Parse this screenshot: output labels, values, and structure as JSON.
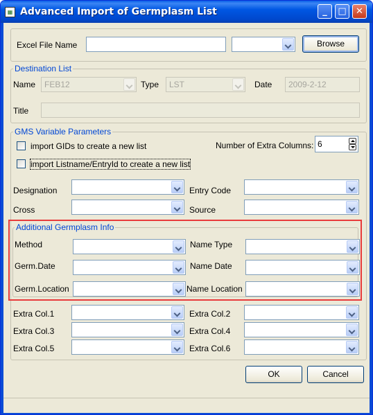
{
  "window": {
    "title": "Advanced Import of Germplasm List"
  },
  "file": {
    "label": "Excel File Name",
    "value": "",
    "sheet": "",
    "browse": "Browse"
  },
  "destination": {
    "legend": "Destination List",
    "name_label": "Name",
    "name_value": "FEB12",
    "type_label": "Type",
    "type_value": "LST",
    "date_label": "Date",
    "date_value": "2009-2-12",
    "title_label": "Title",
    "title_value": ""
  },
  "gms": {
    "legend": "GMS Variable Parameters",
    "import_gids": "import GIDs to create a new list",
    "import_listname": "import Listname/EntryId to create a new list",
    "extra_cols_label": "Number of Extra Columns:",
    "extra_cols_value": "6",
    "designation": "Designation",
    "entry_code": "Entry Code",
    "cross": "Cross",
    "source": "Source"
  },
  "additional": {
    "legend": "Additional Germplasm Info",
    "method": "Method",
    "name_type": "Name Type",
    "germ_date": "Germ.Date",
    "name_date": "Name Date",
    "germ_location": "Germ.Location",
    "name_location": "Name Location"
  },
  "extra": {
    "col1": "Extra Col.1",
    "col2": "Extra Col.2",
    "col3": "Extra Col.3",
    "col4": "Extra Col.4",
    "col5": "Extra Col.5",
    "col6": "Extra Col.6"
  },
  "buttons": {
    "ok": "OK",
    "cancel": "Cancel"
  },
  "colors": {
    "title_bar": "#0054e3",
    "legend_text": "#0046d5",
    "highlight": "#e83b3b",
    "dialog_bg": "#ece9d8"
  }
}
